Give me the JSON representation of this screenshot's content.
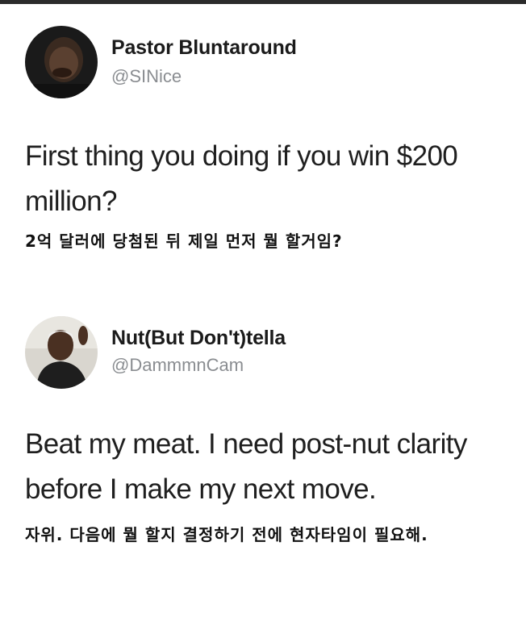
{
  "tweets": [
    {
      "display_name": "Pastor Bluntaround",
      "handle": "@SINice",
      "text": "First thing you doing if you win $200 million?",
      "translation": "2억 달러에 당첨된 뒤 제일 먼저 뭘 할거임?"
    },
    {
      "display_name": "Nut(But Don't)tella",
      "handle": "@DammmnCam",
      "text": "Beat my meat. I need post-nut clarity before I make my next move.",
      "translation": "자위. 다음에 뭘 할지 결정하기 전에 현자타임이 필요해."
    }
  ]
}
